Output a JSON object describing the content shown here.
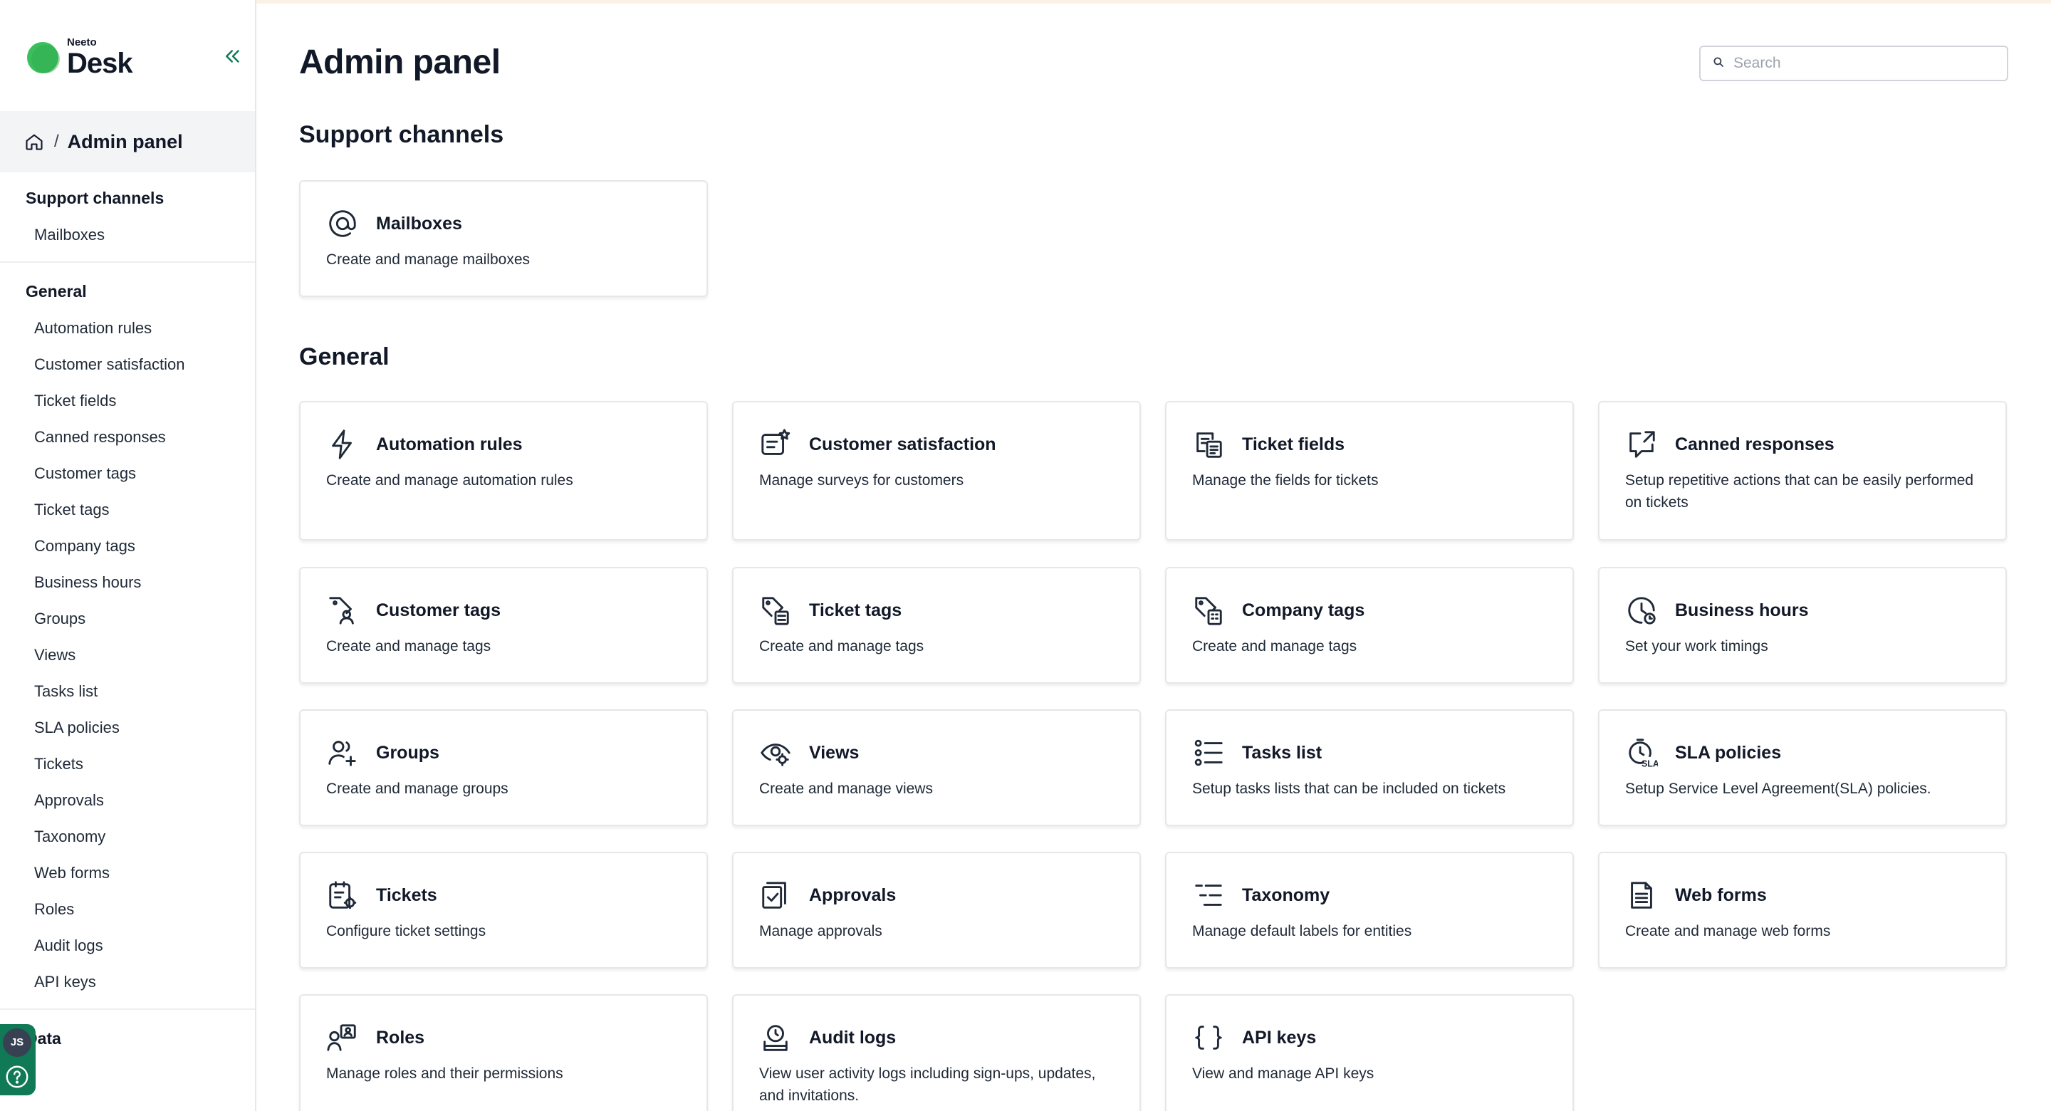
{
  "app": {
    "brand_small": "Neeto",
    "brand_big": "Desk"
  },
  "breadcrumb": {
    "title": "Admin panel"
  },
  "sidebar": {
    "groups": [
      {
        "title": "Support channels",
        "items": [
          "Mailboxes"
        ]
      },
      {
        "title": "General",
        "items": [
          "Automation rules",
          "Customer satisfaction",
          "Ticket fields",
          "Canned responses",
          "Customer tags",
          "Ticket tags",
          "Company tags",
          "Business hours",
          "Groups",
          "Views",
          "Tasks list",
          "SLA policies",
          "Tickets",
          "Approvals",
          "Taxonomy",
          "Web forms",
          "Roles",
          "Audit logs",
          "API keys"
        ]
      },
      {
        "title": "Data",
        "items": []
      }
    ],
    "user_initials": "JS"
  },
  "main": {
    "title": "Admin panel",
    "search": {
      "placeholder": "Search",
      "value": ""
    },
    "sections": [
      {
        "title": "Support channels",
        "cards": [
          {
            "icon": "at-sign-icon",
            "title": "Mailboxes",
            "desc": "Create and manage mailboxes"
          }
        ]
      },
      {
        "title": "General",
        "cards": [
          {
            "icon": "lightning-icon",
            "title": "Automation rules",
            "desc": "Create and manage automation rules"
          },
          {
            "icon": "survey-star-icon",
            "title": "Customer satisfaction",
            "desc": "Manage surveys for customers"
          },
          {
            "icon": "ticket-fields-icon",
            "title": "Ticket fields",
            "desc": "Manage the fields for tickets"
          },
          {
            "icon": "canned-response-icon",
            "title": "Canned responses",
            "desc": "Setup repetitive actions that can be easily performed on tickets"
          },
          {
            "icon": "customer-tag-icon",
            "title": "Customer tags",
            "desc": "Create and manage tags"
          },
          {
            "icon": "ticket-tag-icon",
            "title": "Ticket tags",
            "desc": "Create and manage tags"
          },
          {
            "icon": "company-tag-icon",
            "title": "Company tags",
            "desc": "Create and manage tags"
          },
          {
            "icon": "clock-icon",
            "title": "Business hours",
            "desc": "Set your work timings"
          },
          {
            "icon": "groups-icon",
            "title": "Groups",
            "desc": "Create and manage groups"
          },
          {
            "icon": "eye-settings-icon",
            "title": "Views",
            "desc": "Create and manage views"
          },
          {
            "icon": "task-list-icon",
            "title": "Tasks list",
            "desc": "Setup tasks lists that can be included on tickets"
          },
          {
            "icon": "sla-timer-icon",
            "title": "SLA policies",
            "desc": "Setup Service Level Agreement(SLA) policies."
          },
          {
            "icon": "ticket-settings-icon",
            "title": "Tickets",
            "desc": "Configure ticket settings"
          },
          {
            "icon": "approval-check-icon",
            "title": "Approvals",
            "desc": "Manage approvals"
          },
          {
            "icon": "taxonomy-icon",
            "title": "Taxonomy",
            "desc": "Manage default labels for entities"
          },
          {
            "icon": "document-icon",
            "title": "Web forms",
            "desc": "Create and manage web forms"
          },
          {
            "icon": "roles-icon",
            "title": "Roles",
            "desc": "Manage roles and their permissions"
          },
          {
            "icon": "audit-log-icon",
            "title": "Audit logs",
            "desc": "View user activity logs including sign-ups, updates, and invitations."
          },
          {
            "icon": "braces-icon",
            "title": "API keys",
            "desc": "View and manage API keys"
          }
        ]
      }
    ]
  }
}
